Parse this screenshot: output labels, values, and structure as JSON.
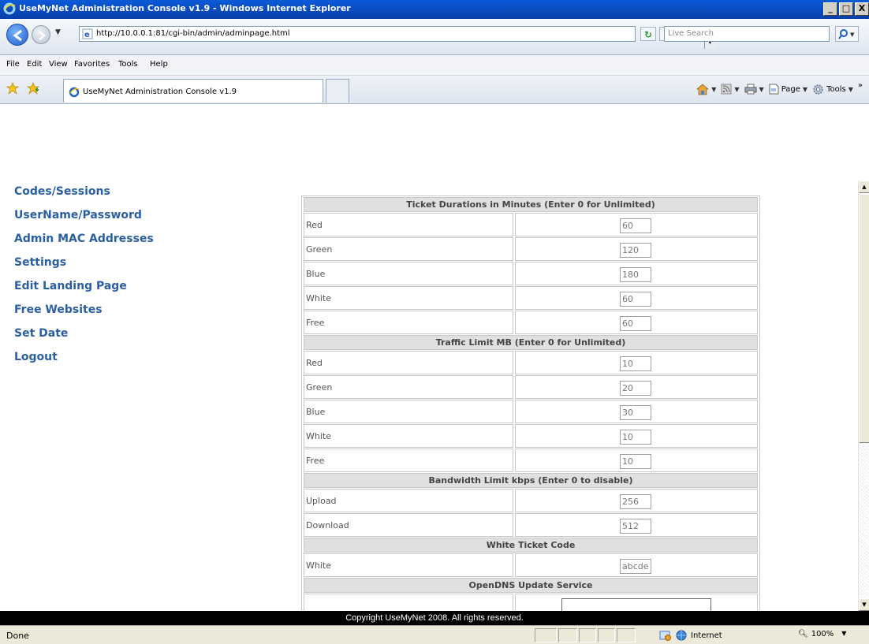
{
  "window": {
    "title": "UseMyNet Administration Console v1.9 - Windows Internet Explorer",
    "min_glyph": "_",
    "max_glyph": "□",
    "close_glyph": "X"
  },
  "address_bar": {
    "url": "http://10.0.0.1:81/cgi-bin/admin/adminpage.html",
    "search_placeholder": "Live Search"
  },
  "menu": {
    "items": [
      "File",
      "Edit",
      "View",
      "Favorites",
      "Tools",
      "Help"
    ]
  },
  "tabs": {
    "active_label": "UseMyNet Administration Console v1.9"
  },
  "command_bar": {
    "page_label": "Page",
    "tools_label": "Tools"
  },
  "sidebar": {
    "items": [
      {
        "label": "Codes/Sessions"
      },
      {
        "label": "UserName/Password"
      },
      {
        "label": "Admin MAC Addresses"
      },
      {
        "label": "Settings"
      },
      {
        "label": "Edit Landing Page"
      },
      {
        "label": "Free Websites"
      },
      {
        "label": "Set Date"
      },
      {
        "label": "Logout"
      }
    ]
  },
  "settings": {
    "durations": {
      "header": "Ticket Durations in Minutes (Enter 0 for Unlimited)",
      "rows": [
        {
          "label": "Red",
          "value": "60"
        },
        {
          "label": "Green",
          "value": "120"
        },
        {
          "label": "Blue",
          "value": "180"
        },
        {
          "label": "White",
          "value": "60"
        },
        {
          "label": "Free",
          "value": "60"
        }
      ]
    },
    "traffic": {
      "header": "Traffic Limit MB (Enter 0 for Unlimited)",
      "rows": [
        {
          "label": "Red",
          "value": "10"
        },
        {
          "label": "Green",
          "value": "20"
        },
        {
          "label": "Blue",
          "value": "30"
        },
        {
          "label": "White",
          "value": "10"
        },
        {
          "label": "Free",
          "value": "10"
        }
      ]
    },
    "bandwidth": {
      "header": "Bandwidth Limit kbps (Enter 0 to disable)",
      "rows": [
        {
          "label": "Upload",
          "value": "256"
        },
        {
          "label": "Download",
          "value": "512"
        }
      ]
    },
    "white_ticket": {
      "header": "White Ticket Code",
      "rows": [
        {
          "label": "White",
          "value": "abcde"
        }
      ]
    },
    "opendns": {
      "header": "OpenDNS Update Service"
    }
  },
  "footer": {
    "text": "Copyright UseMyNet 2008. All rights reserved."
  },
  "status_bar": {
    "status": "Done",
    "zone": "Internet",
    "zoom": "100%"
  }
}
